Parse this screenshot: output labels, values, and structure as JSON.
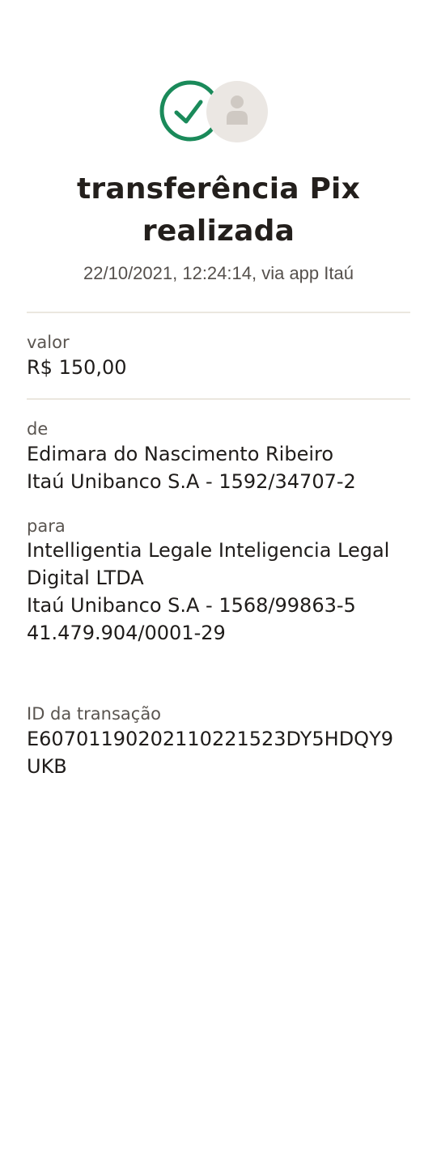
{
  "header": {
    "success_icon": "check-circle-icon",
    "avatar_icon": "person-icon",
    "accent_color": "#1a8a5a",
    "avatar_bg": "#ebe7e3",
    "title_line1": "transferência Pix",
    "title_line2": "realizada",
    "datetime": "22/10/2021,  12:24:14, via app Itaú"
  },
  "valor": {
    "label": "valor",
    "amount": "R$ 150,00"
  },
  "de": {
    "label": "de",
    "name": "Edimara do Nascimento Ribeiro",
    "bank": "Itaú Unibanco S.A - 1592/34707-2"
  },
  "para": {
    "label": "para",
    "name_line1": "Intelligentia Legale Inteligencia Legal",
    "name_line2": "Digital LTDA",
    "bank": "Itaú Unibanco S.A - 1568/99863-5",
    "document": "41.479.904/0001-29"
  },
  "transacao": {
    "label": "ID da transação",
    "id_line1": "E60701190202110221523DY5HDQY9",
    "id_line2": "UKB"
  }
}
